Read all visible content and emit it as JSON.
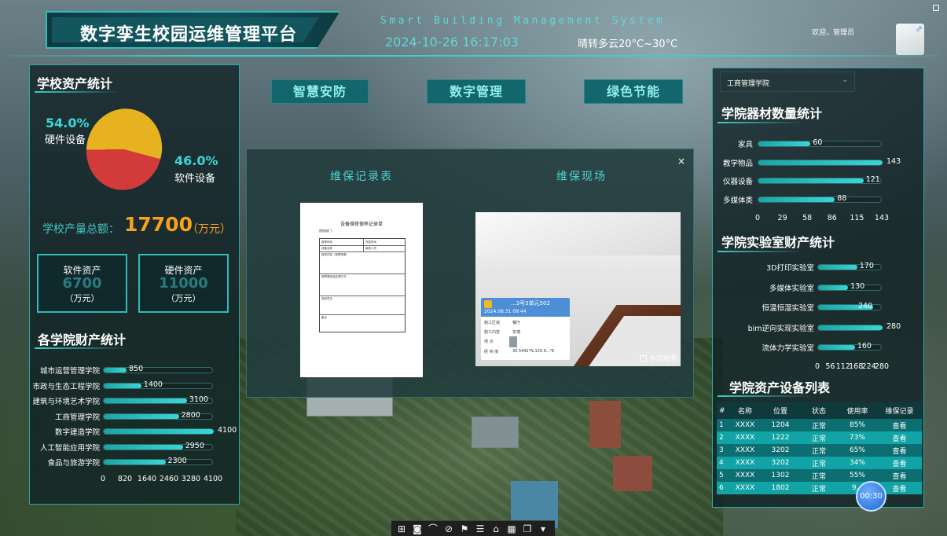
{
  "header": {
    "title": "数字孪生校园运维管理平台",
    "system_en": "Smart Building Management System",
    "datetime": "2024-10-26 16:17:03",
    "weather": "晴转多云20°C~30°C",
    "welcome": "欢迎，管理员",
    "user_icon": "exit-screen-icon"
  },
  "left_panel": {
    "asset_stats_title": "学校资产统计",
    "pie": {
      "hardware_pct": "54.0%",
      "hardware_label": "硬件设备",
      "software_pct": "46.0%",
      "software_label": "软件设备",
      "hardware_value": 54.0,
      "software_value": 46.0,
      "colors": {
        "hardware": "#e6b21f",
        "software": "#d33a3a"
      }
    },
    "total_label": "学校产量总额：",
    "total_value": "17700",
    "total_unit": "（万元）",
    "software_card": {
      "title": "软件资产",
      "value": "6700",
      "unit": "（万元）"
    },
    "hardware_card": {
      "title": "硬件资产",
      "value": "11000",
      "unit": "（万元）"
    },
    "college_title": "各学院财产统计"
  },
  "chart_data": [
    {
      "type": "bar",
      "orientation": "horizontal",
      "title": "各学院财产统计",
      "categories": [
        "城市运营管理学院",
        "市政与生态工程学院",
        "建筑与环境艺术学院",
        "工商管理学院",
        "数字建造学院",
        "人工智能应用学院",
        "食品与旅游学院"
      ],
      "values": [
        850,
        1400,
        3100,
        2800,
        4100,
        2950,
        2300
      ],
      "ticks": [
        "0",
        "820",
        "1640",
        "2460",
        "3280",
        "4100"
      ],
      "xlim": [
        0,
        4100
      ]
    },
    {
      "type": "bar",
      "orientation": "horizontal",
      "title": "学院器材数量统计",
      "categories": [
        "家具",
        "教学物品",
        "仪器设备",
        "多媒体类"
      ],
      "values": [
        60,
        143,
        121,
        88
      ],
      "ticks": [
        "0",
        "29",
        "58",
        "86",
        "115",
        "143"
      ],
      "xlim": [
        0,
        143
      ]
    },
    {
      "type": "bar",
      "orientation": "horizontal",
      "title": "学院实验室财产统计",
      "categories": [
        "3D打印实验室",
        "多媒体实验室",
        "恒温恒湿实验室",
        "bim逆向实现实验室",
        "流体力学实验室"
      ],
      "values": [
        170,
        130,
        240,
        280,
        160
      ],
      "ticks": [
        "0",
        "56",
        "112",
        "168",
        "224",
        "280"
      ],
      "xlim": [
        0,
        280
      ]
    }
  ],
  "center": {
    "buttons": [
      "智慧安防",
      "数字管理",
      "绿色节能"
    ],
    "modal": {
      "left_heading": "维保记录表",
      "right_heading": "维保现场",
      "close": "×",
      "doc_title": "设备维修保养记录单",
      "doc_sub": "报修部门：",
      "doc_cells": [
        "报修时间",
        "完成时间",
        "设备名称",
        "维修人员",
        "报修内容（故障现象）",
        "故障原因及处理方式",
        "验收意见",
        "备注"
      ],
      "stamp": {
        "title": "...3号3单元502",
        "date": "2024.08.31  09:44",
        "rows": [
          {
            "k": "施工区域",
            "v": "餐厅"
          },
          {
            "k": "施工内容",
            "v": "东墙"
          },
          {
            "k": "地    点",
            "v": ""
          },
          {
            "k": "经 纬 度",
            "v": "30.5442°N,120.9...°E"
          }
        ],
        "watermark": "水印相机"
      }
    }
  },
  "right_panel": {
    "dropdown_value": "工商管理学院",
    "equip_title": "学院器材数量统计",
    "lab_title": "学院实验室财产统计",
    "table_title": "学院资产设备列表",
    "table_headers": [
      "#",
      "名称",
      "位置",
      "状态",
      "使用率",
      "维保记录"
    ],
    "table_rows": [
      [
        "1",
        "XXXX",
        "1204",
        "正常",
        "85%",
        "查看"
      ],
      [
        "2",
        "XXXX",
        "1222",
        "正常",
        "73%",
        "查看"
      ],
      [
        "3",
        "XXXX",
        "3202",
        "正常",
        "65%",
        "查看"
      ],
      [
        "4",
        "XXXX",
        "3202",
        "正常",
        "34%",
        "查看"
      ],
      [
        "5",
        "XXXX",
        "1302",
        "正常",
        "55%",
        "查看"
      ],
      [
        "6",
        "XXXX",
        "1802",
        "正常",
        "9...",
        "查看"
      ]
    ],
    "timer": "00:30"
  },
  "toolbar": {
    "icons": [
      "window-icon",
      "screenshot-icon",
      "measure-icon",
      "clock-icon",
      "flag-icon",
      "layers-icon",
      "terrain-icon",
      "grid-icon",
      "copy-icon",
      "dropdown-icon"
    ],
    "glyphs": [
      "⊞",
      "◙",
      "⌒",
      "⊘",
      "⚑",
      "☰",
      "⌂",
      "▦",
      "❐",
      "▾"
    ]
  }
}
